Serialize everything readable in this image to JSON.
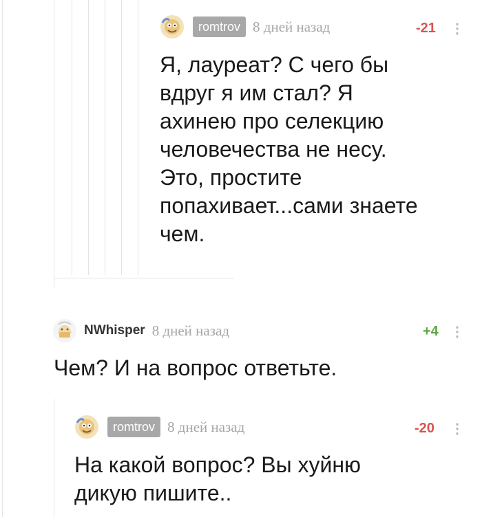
{
  "comments": [
    {
      "author": "romtrov",
      "time": "8 дней назад",
      "rating": "-21",
      "more": "⋮",
      "lines": [
        "Я, лауреат? С чего бы",
        "вдруг я им стал? Я",
        "ахинею про селекцию",
        "человечества не несу.",
        "Это, простите",
        "попахивает...сами знаете",
        "чем."
      ]
    },
    {
      "author": "NWhisper",
      "time": "8 дней назад",
      "rating": "+4",
      "more": "⋮",
      "lines": [
        "Чем? И на вопрос ответьте."
      ]
    },
    {
      "author": "romtrov",
      "time": "8 дней назад",
      "rating": "-20",
      "more": "⋮",
      "lines": [
        "На какой вопрос? Вы хуйню",
        "дикую пишите.."
      ]
    }
  ],
  "colors": {
    "negative": "#d9534f",
    "positive": "#5ca744",
    "badge": "#a8a8a8",
    "muted": "#a6a6a6"
  }
}
